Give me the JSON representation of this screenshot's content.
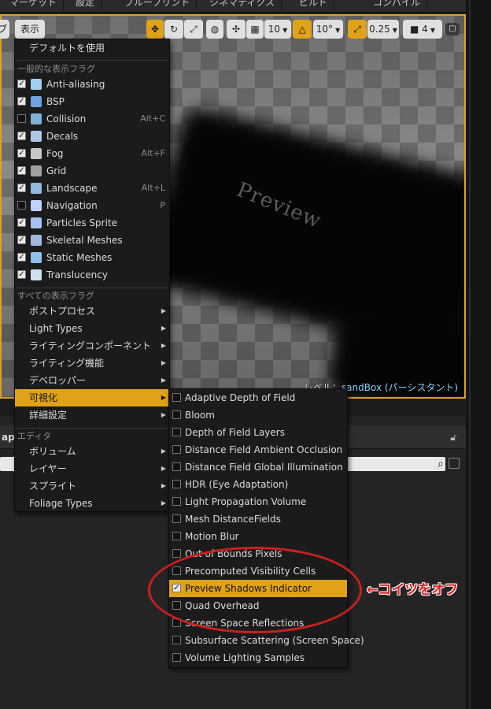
{
  "top_menu": [
    "マーケット",
    "設定",
    "ブループリント",
    "シネマティクス",
    "ビルド",
    "コンパイル"
  ],
  "toolbar": {
    "left_button": "ブ",
    "show_button": "表示",
    "grid_snap_value": "10",
    "rotation_snap_value": "10°",
    "scale_snap_value": "0.25",
    "camera_speed_value": "4"
  },
  "viewport": {
    "preview_text": "Preview",
    "level_prefix": "レベル：",
    "level_name": "sandBox (パーシスタント)"
  },
  "main_menu": {
    "use_defaults": "デフォルトを使用",
    "common_header": "一般的な表示フラグ",
    "common_flags": [
      {
        "label": "Anti-aliasing",
        "checked": true,
        "shortcut": "",
        "icon": "anti-aliasing-icon"
      },
      {
        "label": "BSP",
        "checked": true,
        "shortcut": "",
        "icon": "bsp-icon"
      },
      {
        "label": "Collision",
        "checked": false,
        "shortcut": "Alt+C",
        "icon": "collision-icon"
      },
      {
        "label": "Decals",
        "checked": true,
        "shortcut": "",
        "icon": "decals-icon"
      },
      {
        "label": "Fog",
        "checked": true,
        "shortcut": "Alt+F",
        "icon": "fog-icon"
      },
      {
        "label": "Grid",
        "checked": true,
        "shortcut": "",
        "icon": "grid-icon"
      },
      {
        "label": "Landscape",
        "checked": true,
        "shortcut": "Alt+L",
        "icon": "landscape-icon"
      },
      {
        "label": "Navigation",
        "checked": false,
        "shortcut": "P",
        "icon": "navigation-icon"
      },
      {
        "label": "Particles Sprite",
        "checked": true,
        "shortcut": "",
        "icon": "particles-icon"
      },
      {
        "label": "Skeletal Meshes",
        "checked": true,
        "shortcut": "",
        "icon": "skeletal-mesh-icon"
      },
      {
        "label": "Static Meshes",
        "checked": true,
        "shortcut": "",
        "icon": "static-mesh-icon"
      },
      {
        "label": "Translucency",
        "checked": true,
        "shortcut": "",
        "icon": "translucency-icon"
      }
    ],
    "all_header": "すべての表示フラグ",
    "all_flags": [
      "ポストプロセス",
      "Light Types",
      "ライティングコンポーネント",
      "ライティング機能",
      "デベロッパー",
      "可視化",
      "詳細設定"
    ],
    "all_flags_highlighted": "可視化",
    "editor_header": "エディタ",
    "editor_items": [
      "ボリューム",
      "レイヤー",
      "スプライト",
      "Foliage Types"
    ]
  },
  "visualize_submenu": [
    {
      "label": "Adaptive Depth of Field",
      "checked": false
    },
    {
      "label": "Bloom",
      "checked": false
    },
    {
      "label": "Depth of Field Layers",
      "checked": false
    },
    {
      "label": "Distance Field Ambient Occlusion",
      "checked": false
    },
    {
      "label": "Distance Field Global Illumination",
      "checked": false
    },
    {
      "label": "HDR (Eye Adaptation)",
      "checked": false
    },
    {
      "label": "Light Propagation Volume",
      "checked": false
    },
    {
      "label": "Mesh DistanceFields",
      "checked": false
    },
    {
      "label": "Motion Blur",
      "checked": false
    },
    {
      "label": "Out of Bounds Pixels",
      "checked": false
    },
    {
      "label": "Precomputed Visibility Cells",
      "checked": false
    },
    {
      "label": "Preview Shadows Indicator",
      "checked": true,
      "highlighted": true
    },
    {
      "label": "Quad Overhead",
      "checked": false
    },
    {
      "label": "Screen Space Reflections",
      "checked": false
    },
    {
      "label": "Subsurface Scattering (Screen Space)",
      "checked": false
    },
    {
      "label": "Volume Lighting Samples",
      "checked": false
    }
  ],
  "lower_panel": {
    "tab_label": "aps"
  },
  "annotation": {
    "text": "←コイツをオフ",
    "color": "#d61e1e"
  },
  "colors": {
    "accent": "#e0a21a",
    "menu_bg": "#1b1b1b"
  }
}
